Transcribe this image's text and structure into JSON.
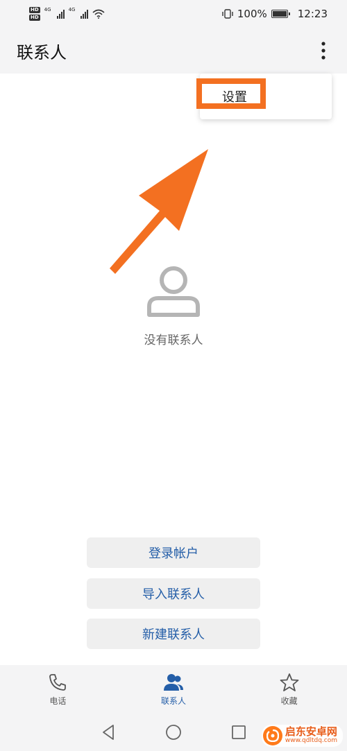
{
  "status_bar": {
    "hd_badge": "HD",
    "network_1": "4G",
    "network_2": "4G",
    "battery_percent": "100%",
    "time": "12:23"
  },
  "app_bar": {
    "title": "联系人",
    "more_icon": "more-vertical-icon"
  },
  "popup_menu": {
    "items": [
      {
        "label": "设置"
      }
    ]
  },
  "annotation": {
    "color": "#f37021"
  },
  "empty_state": {
    "icon": "person-icon",
    "text": "没有联系人"
  },
  "actions": {
    "login_label": "登录帐户",
    "import_label": "导入联系人",
    "new_label": "新建联系人"
  },
  "bottom_nav": {
    "items": [
      {
        "label": "电话",
        "icon": "phone-icon",
        "active": false
      },
      {
        "label": "联系人",
        "icon": "contacts-icon",
        "active": true
      },
      {
        "label": "收藏",
        "icon": "star-icon",
        "active": false
      }
    ]
  },
  "system_nav": {
    "back": "back-icon",
    "home": "home-icon",
    "recents": "recents-icon"
  },
  "watermark": {
    "title": "启东安卓网",
    "url": "www.qdltdq.com"
  },
  "colors": {
    "accent": "#245ea8",
    "annotation": "#f37021",
    "background": "#ffffff",
    "bars": "#f4f4f5"
  }
}
